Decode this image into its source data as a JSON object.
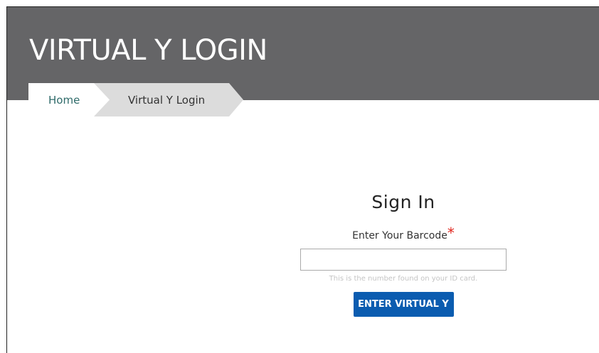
{
  "header": {
    "title": "VIRTUAL Y LOGIN"
  },
  "breadcrumb": {
    "home": "Home",
    "current": "Virtual Y Login"
  },
  "signin": {
    "heading": "Sign In",
    "barcode_label": "Enter Your Barcode",
    "required_marker": "*",
    "barcode_value": "",
    "hint": "This is the number found on your ID card.",
    "submit_label": "ENTER VIRTUAL Y"
  },
  "colors": {
    "banner": "#656567",
    "breadcrumb_current_bg": "#dcdcdc",
    "home_link": "#2f6b6a",
    "button": "#0b5cb0",
    "required": "#e0271f"
  }
}
